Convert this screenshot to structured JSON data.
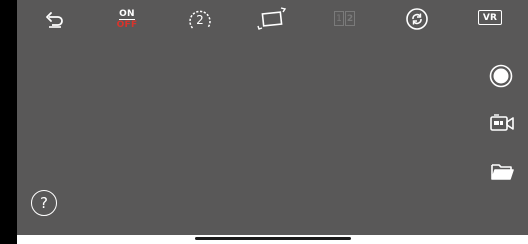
{
  "toolbar": {
    "back_icon": "back-arrow-icon",
    "power_toggle": {
      "on_label": "ON",
      "off_label": "OFF",
      "off_color": "#d9332b"
    },
    "dial": {
      "icon": "dial-icon",
      "value": "2"
    },
    "rotate_icon": "rotate-screen-icon",
    "split": {
      "icon": "split-screen-icon",
      "label_left": "1",
      "label_right": "2",
      "enabled": false
    },
    "sync_icon": "refresh-icon",
    "vr_label": "VR"
  },
  "side_controls": {
    "shutter_icon": "shutter-icon",
    "video_icon": "video-camera-icon",
    "folder_icon": "folder-icon"
  },
  "help_label": "?",
  "colors": {
    "viewport_bg": "#595858",
    "left_bar": "#000000",
    "icon": "#ffffff",
    "disabled_icon": "#7a7a7a"
  }
}
